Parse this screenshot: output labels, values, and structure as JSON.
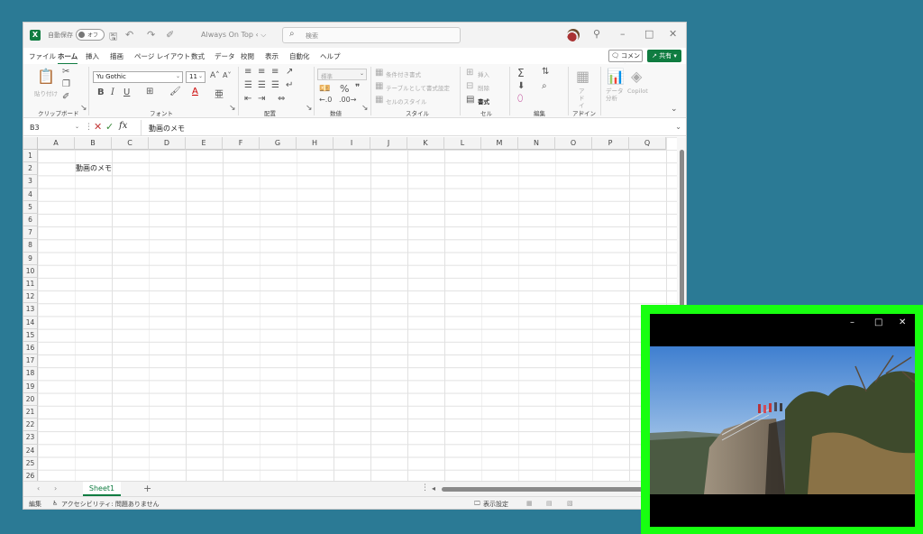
{
  "excel": {
    "titlebar": {
      "app_icon": "X",
      "autosave_label": "自動保存",
      "autosave_state": "オフ",
      "doc_title": "Always On Top ‹ ⌵",
      "search_placeholder": "検索",
      "icons": [
        "save-icon",
        "undo-icon",
        "redo-icon",
        "brush-icon",
        "pin-icon",
        "minimize-icon",
        "maximize-icon",
        "close-icon"
      ]
    },
    "menu": {
      "tabs": [
        "ファイル",
        "ホーム",
        "挿入",
        "描画",
        "ページ レイアウト",
        "数式",
        "データ",
        "校閲",
        "表示",
        "自動化",
        "ヘルプ"
      ],
      "active_tab": "ホーム",
      "comment_label": "コメント",
      "share_label": "共有"
    },
    "ribbon": {
      "clipboard": {
        "paste_label": "貼り付け",
        "group_label": "クリップボード"
      },
      "font": {
        "font_name": "Yu Gothic",
        "font_size": "11",
        "group_label": "フォント",
        "bold": "B",
        "italic": "I",
        "underline": "U"
      },
      "alignment": {
        "group_label": "配置"
      },
      "number": {
        "format": "標準",
        "group_label": "数値",
        "percent": "%"
      },
      "styles": {
        "conditional": "条件付き書式",
        "as_table": "テーブルとして書式設定",
        "cell_styles": "セルのスタイル",
        "group_label": "スタイル"
      },
      "cells": {
        "insert": "挿入",
        "delete": "削除",
        "format": "書式",
        "group_label": "セル"
      },
      "editing": {
        "group_label": "編集"
      },
      "addins": {
        "label": "アド イン",
        "group_label": "アドイン"
      },
      "analysis": {
        "label": "データ 分析"
      },
      "copilot": {
        "label": "Copilot"
      }
    },
    "formula_bar": {
      "name_box": "B3",
      "content": "動画のメモ"
    },
    "grid": {
      "columns": [
        "A",
        "B",
        "C",
        "D",
        "E",
        "F",
        "G",
        "H",
        "I",
        "J",
        "K",
        "L",
        "M",
        "N",
        "O",
        "P",
        "Q"
      ],
      "rows": [
        "1",
        "2",
        "3",
        "4",
        "5",
        "6",
        "7",
        "8",
        "9",
        "10",
        "11",
        "12",
        "13",
        "14",
        "15",
        "16",
        "17",
        "18",
        "19",
        "20",
        "21",
        "22",
        "23",
        "24",
        "25",
        "26"
      ],
      "cell_b3": "動画のメモ"
    },
    "sheets": {
      "tabs": [
        "Sheet1"
      ],
      "active": "Sheet1",
      "add": "+"
    },
    "status": {
      "mode": "編集",
      "accessibility": "アクセシビリティ: 問題ありません",
      "display_settings": "表示設定"
    }
  },
  "video_window": {
    "border_color": "#18ff10",
    "controls": [
      "minimize-icon",
      "maximize-icon",
      "close-icon"
    ]
  }
}
